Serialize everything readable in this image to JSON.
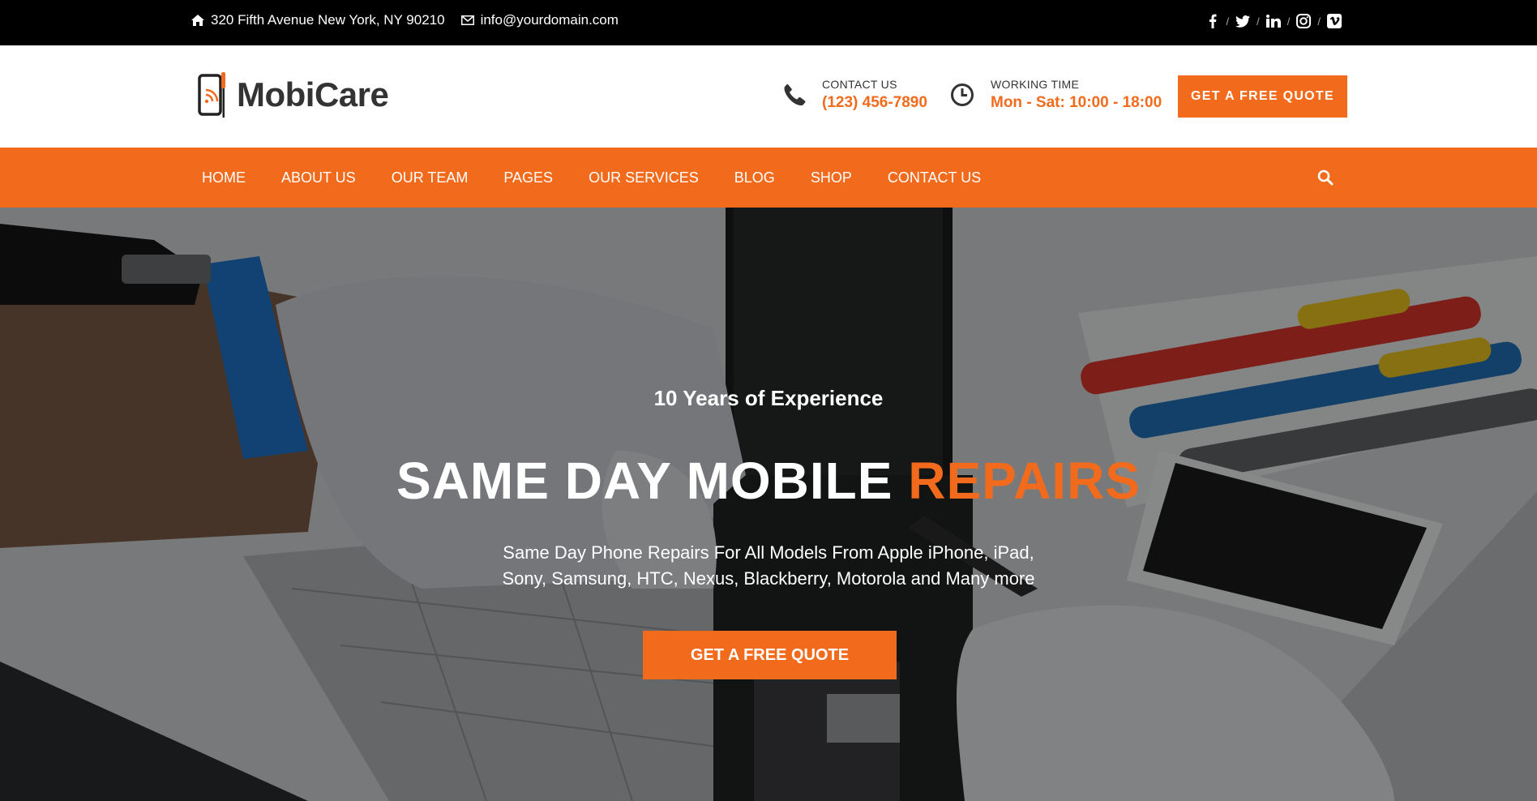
{
  "topbar": {
    "address": "320 Fifth Avenue New York, NY 90210",
    "email": "info@yourdomain.com",
    "social": [
      {
        "icon": "facebook-icon",
        "glyph": "f"
      },
      {
        "icon": "twitter-icon",
        "glyph": "t"
      },
      {
        "icon": "linkedin-icon",
        "glyph": "in"
      },
      {
        "icon": "instagram-icon",
        "glyph": "ig"
      },
      {
        "icon": "vimeo-icon",
        "glyph": "v"
      }
    ]
  },
  "header": {
    "logo_text": "MobiCare",
    "contact_label": "CONTACT US",
    "contact_value": "(123) 456-7890",
    "working_label": "WORKING TIME",
    "working_value": "Mon - Sat: 10:00 - 18:00",
    "quote_button": "GET A FREE QUOTE"
  },
  "nav": {
    "items": [
      "HOME",
      "ABOUT US",
      "OUR TEAM",
      "PAGES",
      "OUR SERVICES",
      "BLOG",
      "SHOP",
      "CONTACT US"
    ]
  },
  "hero": {
    "kicker": "10 Years of Experience",
    "title_main": "SAME DAY MOBILE ",
    "title_accent": "REPAIRS",
    "desc_line1": "Same Day Phone Repairs For All Models From Apple iPhone, iPad,",
    "desc_line2": "Sony, Samsung, HTC, Nexus, Blackberry, Motorola and Many more",
    "cta": "GET A FREE QUOTE"
  },
  "colors": {
    "accent": "#f26b1d",
    "topbar": "#000000"
  }
}
